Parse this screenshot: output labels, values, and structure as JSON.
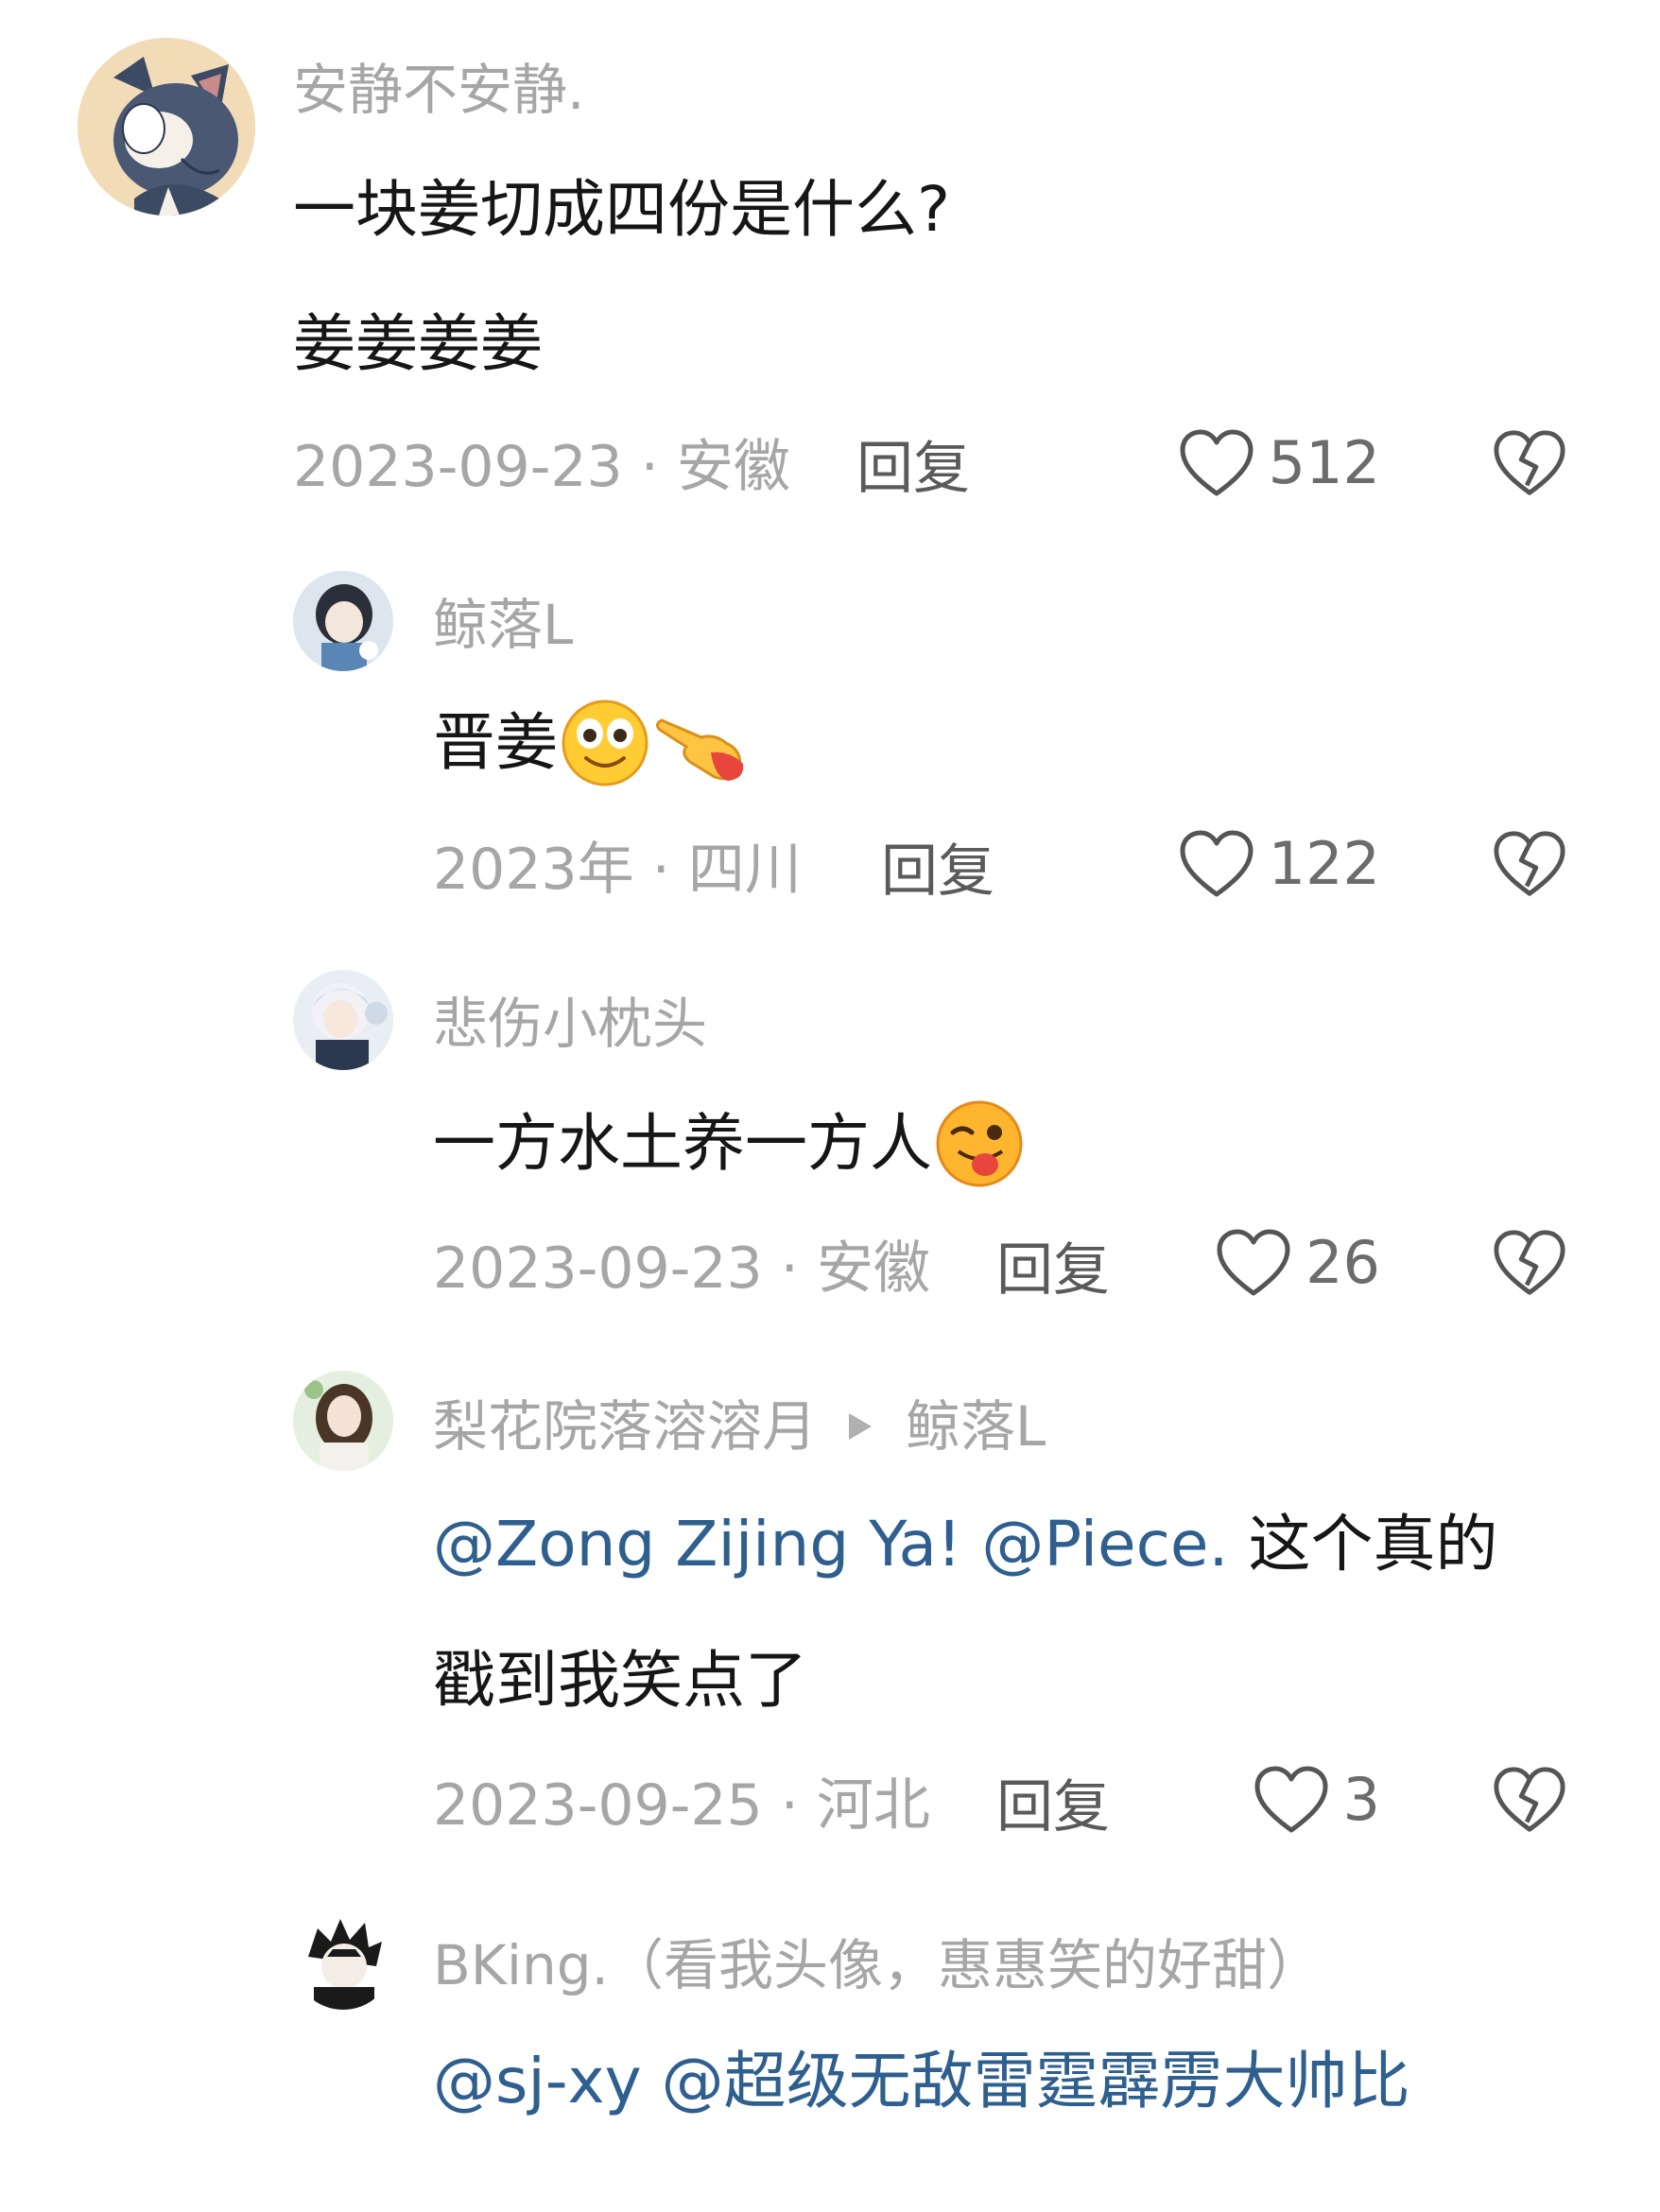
{
  "colors": {
    "username": "#a6a6a6",
    "content": "#161616",
    "mention": "#2e5f8f",
    "meta": "#a6a6a6",
    "reply": "#5a5a5a",
    "like": "#6c6c6c"
  },
  "comments": [
    {
      "username": "安静不安静.",
      "lines": [
        "一块姜切成四份是什么?",
        "姜姜姜姜"
      ],
      "date_location": "2023-09-23 · 安徽",
      "reply_label": "回复",
      "likes": "512",
      "avatar_icon": "tom-cat-avatar-icon"
    },
    {
      "username": "鲸落L",
      "text": "晋姜",
      "emojis": [
        "smiling-face-emoji",
        "pointing-hand-emoji"
      ],
      "date_location": "2023年 · 四川",
      "reply_label": "回复",
      "likes": "122",
      "avatar_icon": "anime-girl-avatar-icon"
    },
    {
      "username": "悲伤小枕头",
      "text": "一方水土养一方人",
      "emojis": [
        "winking-tongue-emoji"
      ],
      "date_location": "2023-09-23 · 安徽",
      "reply_label": "回复",
      "likes": "26",
      "avatar_icon": "anime-girl-avatar-icon"
    },
    {
      "username": "梨花院落溶溶月",
      "reply_to": "鲸落L",
      "mentions": [
        "@Zong Zijing Ya!",
        "@Piece."
      ],
      "text_after": "这个真的",
      "line2": "戳到我笑点了",
      "date_location": "2023-09-25 · 河北",
      "reply_label": "回复",
      "likes": "3",
      "avatar_icon": "girl-photo-avatar-icon"
    },
    {
      "username": "BKing.（看我头像，惠惠笑的好甜）",
      "mentions": [
        "@sj-xy",
        "@超级无敌雷霆霹雳大帅比"
      ],
      "avatar_icon": "anime-boy-avatar-icon"
    }
  ]
}
